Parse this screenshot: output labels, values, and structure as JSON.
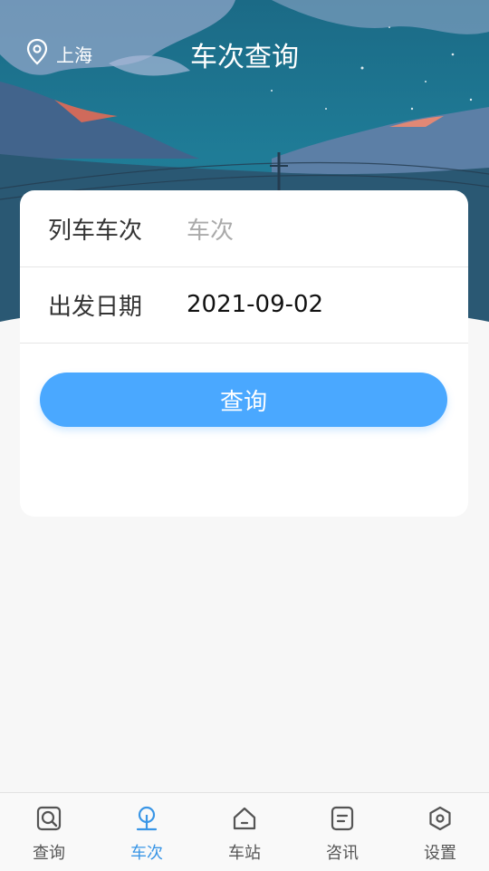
{
  "header": {
    "location": "上海",
    "title": "车次查询"
  },
  "form": {
    "train_label": "列车车次",
    "train_placeholder": "车次",
    "date_label": "出发日期",
    "date_value": "2021-09-02",
    "submit_label": "查询"
  },
  "tabbar": {
    "items": [
      {
        "label": "查询",
        "icon": "search-doc-icon",
        "active": false
      },
      {
        "label": "车次",
        "icon": "train-icon",
        "active": true
      },
      {
        "label": "车站",
        "icon": "home-icon",
        "active": false
      },
      {
        "label": "咨讯",
        "icon": "news-icon",
        "active": false
      },
      {
        "label": "设置",
        "icon": "settings-hex-icon",
        "active": false
      }
    ]
  },
  "colors": {
    "accent": "#4aa8ff",
    "active_tab": "#3a96e6",
    "hero_sky": "#1f7c97"
  }
}
